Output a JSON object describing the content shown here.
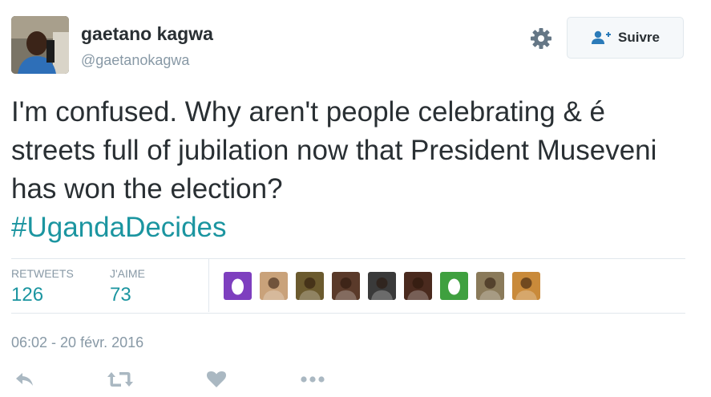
{
  "author": {
    "name": "gaetano kagwa",
    "handle": "@gaetanokagwa"
  },
  "follow_button": {
    "label": "Suivre",
    "icon": "add-user-icon"
  },
  "settings_icon": "gear-icon",
  "tweet": {
    "text": "I'm confused. Why aren't people celebrating & é streets full of jubilation now that President Museveni has won the election?",
    "hashtag": "#UgandaDecides"
  },
  "stats": {
    "retweets_label": "RETWEETS",
    "retweets_count": "126",
    "likes_label": "J'AIME",
    "likes_count": "73"
  },
  "likers": [
    {
      "kind": "egg",
      "color": "#7e3fbf"
    },
    {
      "kind": "photo",
      "color": "#c9a27a"
    },
    {
      "kind": "photo",
      "color": "#6b5a2e"
    },
    {
      "kind": "photo",
      "color": "#5a3a2a"
    },
    {
      "kind": "photo",
      "color": "#3a3a3a"
    },
    {
      "kind": "photo",
      "color": "#4a2a1e"
    },
    {
      "kind": "egg",
      "color": "#3fa03f"
    },
    {
      "kind": "photo",
      "color": "#8a7a5a"
    },
    {
      "kind": "photo",
      "color": "#c98a3a"
    }
  ],
  "timestamp": "06:02 - 20 févr. 2016",
  "actions": [
    {
      "name": "reply",
      "icon": "reply-icon"
    },
    {
      "name": "retweet",
      "icon": "retweet-icon"
    },
    {
      "name": "like",
      "icon": "heart-icon"
    },
    {
      "name": "more",
      "icon": "more-dots-icon"
    }
  ],
  "colors": {
    "link": "#1b95a0",
    "muted": "#8899a6",
    "text": "#292f33",
    "follow_icon": "#2b7bb9",
    "action_icon": "#aab8c2"
  }
}
